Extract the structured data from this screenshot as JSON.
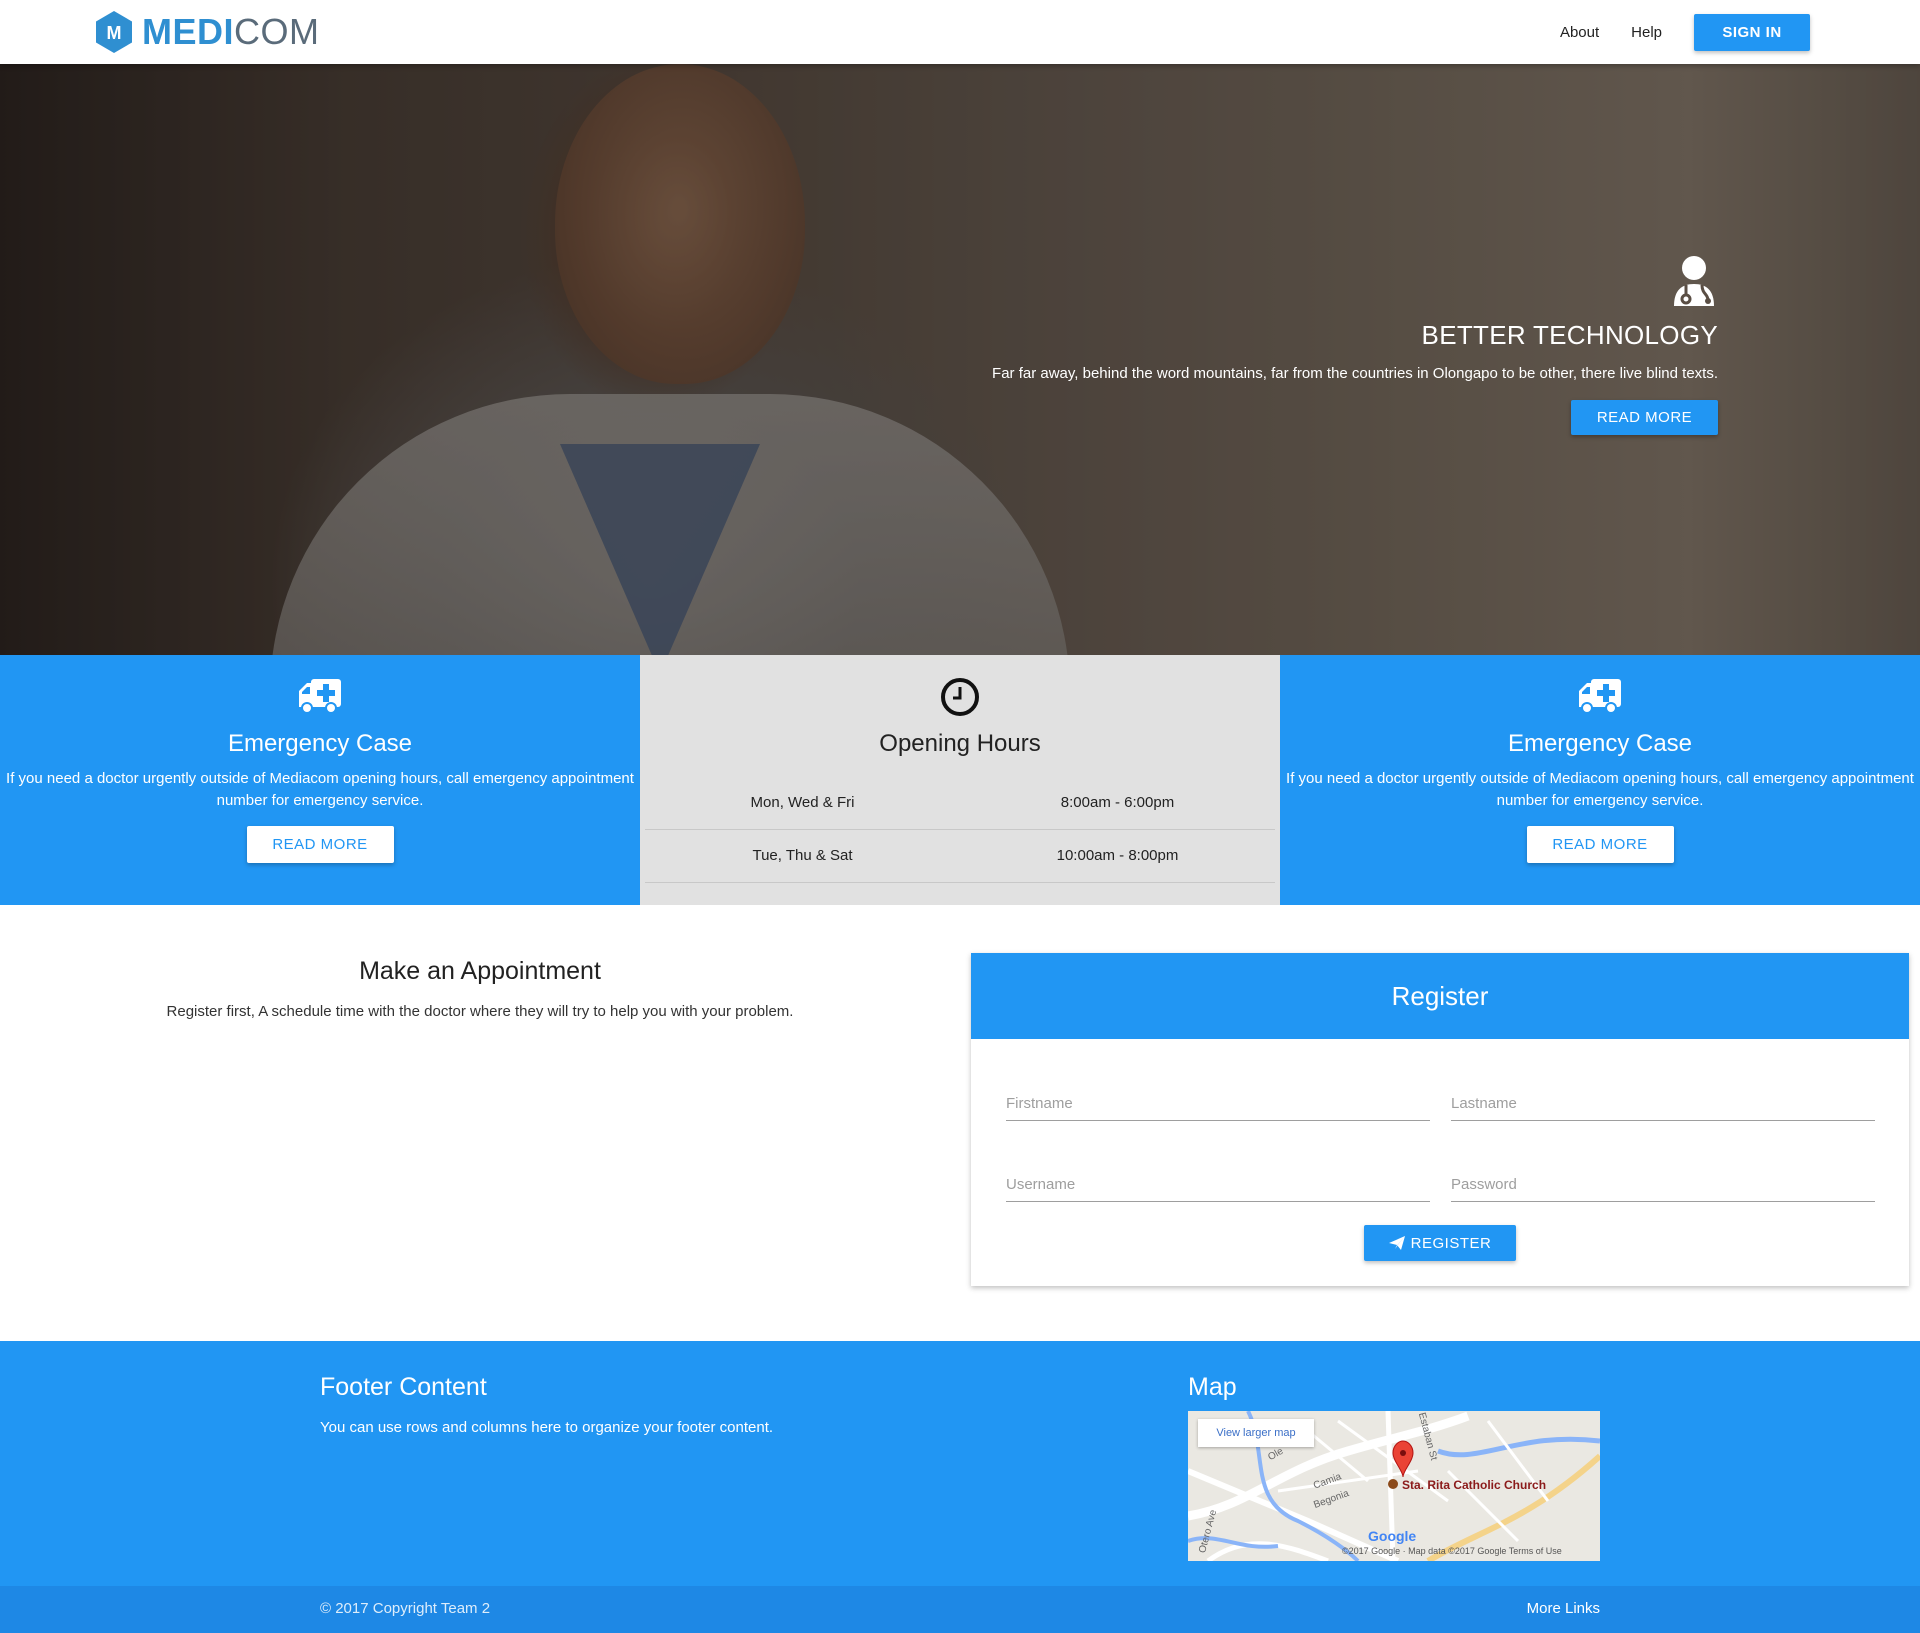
{
  "brand": {
    "logo_letter": "M",
    "name_bold": "MEDI",
    "name_light": "COM",
    "accent": "#2196f3"
  },
  "nav": {
    "links": [
      "About",
      "Help"
    ],
    "signin_label": "SIGN IN"
  },
  "hero": {
    "icon": "doctor-icon",
    "title": "BETTER TECHNOLOGY",
    "text": "Far far away, behind the word mountains, far from the countries in Olongapo to be other, there live blind texts.",
    "button_label": "READ MORE"
  },
  "panels": {
    "left": {
      "icon": "ambulance-icon",
      "title": "Emergency Case",
      "text": "If you need a doctor urgently outside of Mediacom opening hours, call emergency appointment number for emergency service.",
      "button_label": "READ MORE"
    },
    "center": {
      "icon": "clock-icon",
      "title": "Opening Hours",
      "rows": [
        {
          "days": "Mon, Wed & Fri",
          "hours": "8:00am - 6:00pm"
        },
        {
          "days": "Tue, Thu & Sat",
          "hours": "10:00am - 8:00pm"
        }
      ]
    },
    "right": {
      "icon": "ambulance-icon",
      "title": "Emergency Case",
      "text": "If you need a doctor urgently outside of Mediacom opening hours, call emergency appointment number for emergency service.",
      "button_label": "READ MORE"
    }
  },
  "appointment": {
    "title": "Make an Appointment",
    "text": "Register first, A schedule time with the doctor where they will try to help you with your problem."
  },
  "register": {
    "title": "Register",
    "fields": {
      "firstname": "Firstname",
      "lastname": "Lastname",
      "username": "Username",
      "password": "Password"
    },
    "button_icon": "paper-plane-icon",
    "button_label": "REGISTER"
  },
  "footer": {
    "title": "Footer Content",
    "text": "You can use rows and columns here to organize your footer content.",
    "map_title": "Map",
    "map": {
      "view_larger": "View larger map",
      "place": "Sta. Rita Catholic Church",
      "streets": [
        "Estaban St",
        "Camia",
        "Begonia",
        "Otero Ave",
        "Ole"
      ],
      "google": "Google",
      "attribution": "©2017 Google · Map data ©2017 Google    Terms of Use"
    },
    "copyright": "© 2017 Copyright Team 2",
    "more_links": "More Links"
  }
}
